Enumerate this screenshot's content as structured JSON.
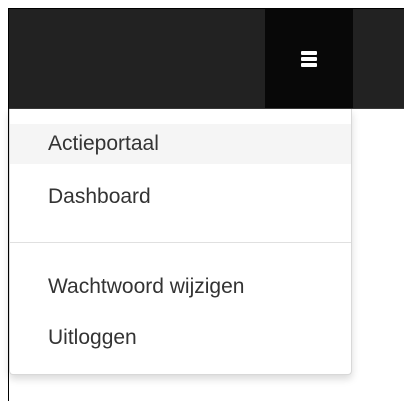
{
  "navbar": {
    "toggle_icon": "hamburger-menu-icon",
    "background_color": "#222222",
    "toggle_background_color": "#080808"
  },
  "menu": {
    "items": [
      {
        "label": "Actieportaal",
        "active": true
      },
      {
        "label": "Dashboard",
        "active": false
      },
      {
        "label": "Wachtwoord wijzigen",
        "active": false
      },
      {
        "label": "Uitloggen",
        "active": false
      }
    ],
    "text_color": "#333333",
    "active_background": "#f5f5f5"
  }
}
